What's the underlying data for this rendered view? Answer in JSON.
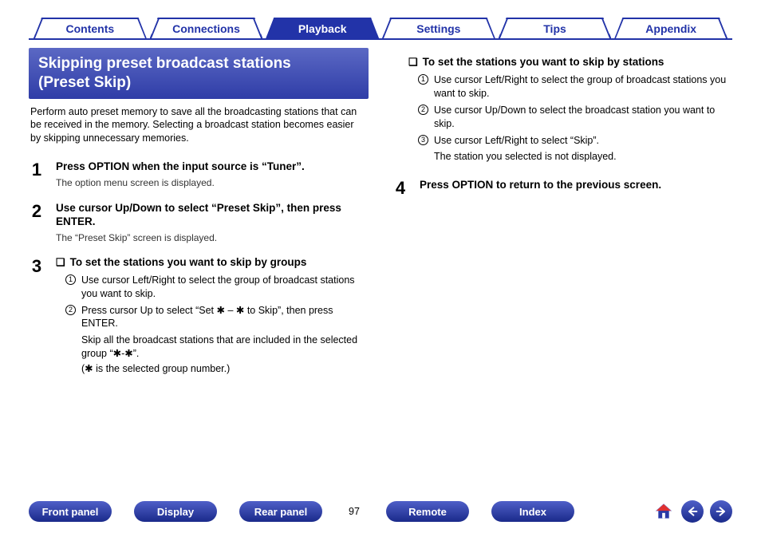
{
  "tabs": {
    "items": [
      "Contents",
      "Connections",
      "Playback",
      "Settings",
      "Tips",
      "Appendix"
    ],
    "active_index": 2
  },
  "panel": {
    "title_line1": "Skipping preset broadcast stations",
    "title_line2": "(Preset Skip)",
    "intro": "Perform auto preset memory to save all the broadcasting stations that can be received in the memory. Selecting a broadcast station becomes easier by skipping unnecessary memories."
  },
  "steps": {
    "s1": {
      "num": "1",
      "head": "Press OPTION when the input source is “Tuner”.",
      "note": "The option menu screen is displayed."
    },
    "s2": {
      "num": "2",
      "head": "Use cursor Up/Down to select “Preset Skip”, then press ENTER.",
      "note": "The “Preset Skip” screen is displayed."
    },
    "s3": {
      "num": "3",
      "sub_head": "To set the stations you want to skip by groups",
      "items": [
        "Use cursor Left/Right to select the group of broadcast stations you want to skip.",
        "Press cursor Up to select “Set ✱ – ✱ to Skip”, then press ENTER."
      ],
      "trail1": "Skip all the broadcast stations that are included in the selected group “✱-✱”.",
      "trail2": "(✱ is the selected group number.)"
    },
    "s3b": {
      "sub_head": "To set the stations you want to skip by stations",
      "items": [
        "Use cursor Left/Right to select the group of broadcast stations you want to skip.",
        "Use cursor Up/Down to select the broadcast station you want to skip.",
        "Use cursor Left/Right to select “Skip”."
      ],
      "trail1": "The station you selected is not displayed."
    },
    "s4": {
      "num": "4",
      "head": "Press OPTION to return to the previous screen."
    }
  },
  "footer": {
    "buttons": [
      "Front panel",
      "Display",
      "Rear panel"
    ],
    "page": "97",
    "buttons2": [
      "Remote",
      "Index"
    ]
  }
}
